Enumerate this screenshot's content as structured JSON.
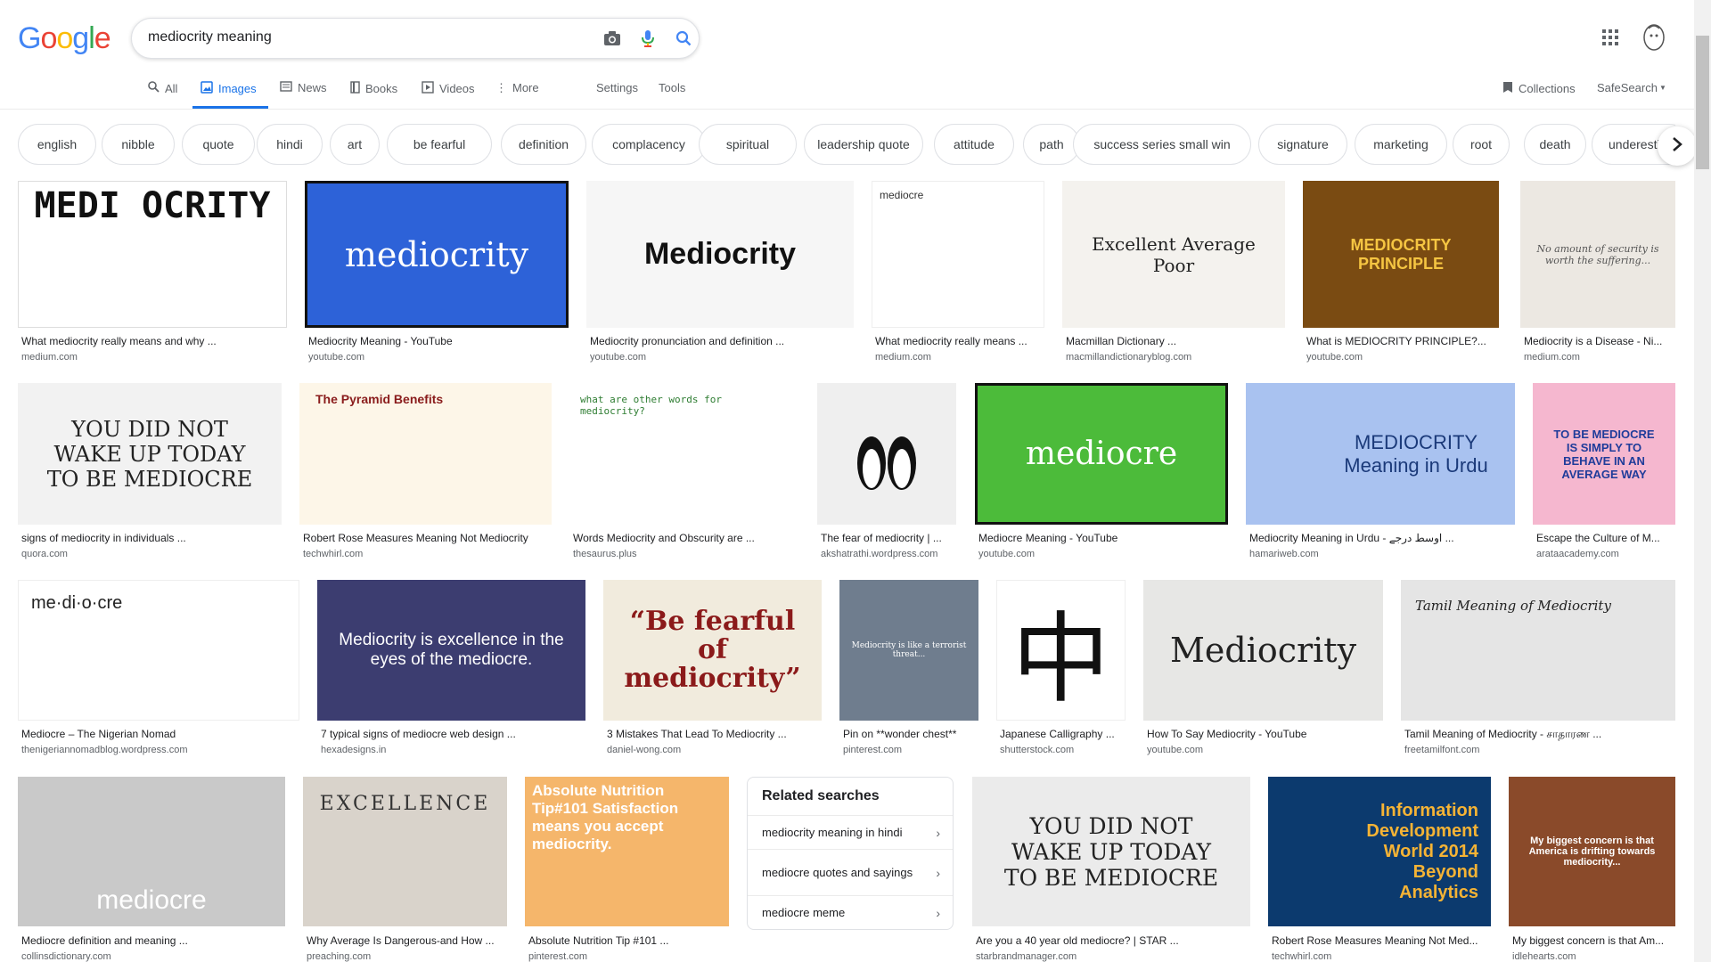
{
  "header": {
    "logo": [
      "G",
      "o",
      "o",
      "g",
      "l",
      "e"
    ],
    "logo_colors": [
      "#4285F4",
      "#EA4335",
      "#FBBC05",
      "#4285F4",
      "#34A853",
      "#EA4335"
    ],
    "query": "mediocrity meaning"
  },
  "tabs": [
    {
      "label": "All",
      "icon": "search-icon"
    },
    {
      "label": "Images",
      "icon": "image-icon"
    },
    {
      "label": "News",
      "icon": "news-icon"
    },
    {
      "label": "Books",
      "icon": "book-icon"
    },
    {
      "label": "Videos",
      "icon": "video-icon"
    },
    {
      "label": "More",
      "icon": "more-icon"
    }
  ],
  "tools": {
    "settings": "Settings",
    "tools": "Tools",
    "collections": "Collections",
    "safesearch": "SafeSearch"
  },
  "chips": [
    "english",
    "nibble",
    "quote",
    "hindi",
    "art",
    "be fearful",
    "definition",
    "complacency",
    "spiritual",
    "leadership quote",
    "attitude",
    "path",
    "success series small win",
    "signature",
    "marketing",
    "root",
    "death",
    "underesti"
  ],
  "results": [
    {
      "title": "What mediocrity really means and why ...",
      "site": "medium.com",
      "thumb_text": "MEDI OCRITY",
      "bg": "#ffffff",
      "fg": "#111111"
    },
    {
      "title": "Mediocrity Meaning - YouTube",
      "site": "youtube.com",
      "thumb_text": "mediocrity",
      "bg": "#2d62d8",
      "fg": "#ffffff"
    },
    {
      "title": "Mediocrity pronunciation and definition ...",
      "site": "youtube.com",
      "thumb_text": "Mediocrity",
      "bg": "#f6f6f6",
      "fg": "#111111"
    },
    {
      "title": "What mediocrity really means ...",
      "site": "medium.com",
      "thumb_text": "mediocre",
      "bg": "#ffffff",
      "fg": "#333333"
    },
    {
      "title": "Macmillan Dictionary ...",
      "site": "macmillandictionaryblog.com",
      "thumb_text": "Excellent Average Poor",
      "bg": "#f4f2ee",
      "fg": "#222222"
    },
    {
      "title": "What is MEDIOCRITY PRINCIPLE?...",
      "site": "youtube.com",
      "thumb_text": "MEDIOCRITY PRINCIPLE",
      "bg": "#7a4b12",
      "fg": "#f5c542"
    },
    {
      "title": "Mediocrity is a Disease - Ni...",
      "site": "medium.com",
      "thumb_text": "No amount of security is worth the suffering...",
      "bg": "#ece8e2",
      "fg": "#555555"
    },
    {
      "title": "signs of mediocrity in individuals ...",
      "site": "quora.com",
      "thumb_text": "YOU DID NOT WAKE UP TODAY TO BE MEDIOCRE",
      "bg": "#f2f2f2",
      "fg": "#222222"
    },
    {
      "title": "Robert Rose Measures Meaning Not Mediocrity",
      "site": "techwhirl.com",
      "thumb_text": "The Pyramid Benefits",
      "bg": "#fdf6e8",
      "fg": "#8a1c1c"
    },
    {
      "title": "Words Mediocrity and Obscurity are ...",
      "site": "thesaurus.plus",
      "thumb_text": "what are other words for mediocrity?",
      "bg": "#ffffff",
      "fg": "#2e7d32"
    },
    {
      "title": "The fear of mediocrity | ...",
      "site": "akshatrathi.wordpress.com",
      "thumb_text": "penguins",
      "bg": "#efefef",
      "fg": "#222222"
    },
    {
      "title": "Mediocre Meaning - YouTube",
      "site": "youtube.com",
      "thumb_text": "mediocre",
      "bg": "#4cbb3a",
      "fg": "#ffffff"
    },
    {
      "title": "Mediocrity Meaning in Urdu - اوسط درجے ...",
      "site": "hamariweb.com",
      "thumb_text": "MEDIOCRITY Meaning in Urdu",
      "bg": "#a9c2f0",
      "fg": "#1b3a7a"
    },
    {
      "title": "Escape the Culture of M...",
      "site": "arataacademy.com",
      "thumb_text": "TO BE MEDIOCRE IS SIMPLY TO BEHAVE IN AN AVERAGE WAY",
      "bg": "#f5b7cf",
      "fg": "#1f3c9a"
    },
    {
      "title": "Mediocre – The Nigerian Nomad",
      "site": "thenigeriannomadblog.wordpress.com",
      "thumb_text": "me·di·o·cre",
      "bg": "#ffffff",
      "fg": "#222222"
    },
    {
      "title": "7 typical signs of mediocre web design ...",
      "site": "hexadesigns.in",
      "thumb_text": "Mediocrity is excellence in the eyes of the mediocre.",
      "bg": "#3c3d70",
      "fg": "#ffffff"
    },
    {
      "title": "3 Mistakes That Lead To Mediocrity ...",
      "site": "daniel-wong.com",
      "thumb_text": "“Be fearful of mediocrity”",
      "bg": "#f1ebdd",
      "fg": "#8b1a1a"
    },
    {
      "title": "Pin on **wonder chest**",
      "site": "pinterest.com",
      "thumb_text": "Mediocrity is like a terrorist threat...",
      "bg": "#6f7d8e",
      "fg": "#ffffff"
    },
    {
      "title": "Japanese Calligraphy ...",
      "site": "shutterstock.com",
      "thumb_text": "中",
      "bg": "#ffffff",
      "fg": "#111111"
    },
    {
      "title": "How To Say Mediocrity - YouTube",
      "site": "youtube.com",
      "thumb_text": "Mediocrity",
      "bg": "#e7e7e5",
      "fg": "#222222"
    },
    {
      "title": "Tamil Meaning of Mediocrity - சாதாரண ...",
      "site": "freetamilfont.com",
      "thumb_text": "Tamil Meaning of Mediocrity",
      "bg": "#e5e5e5",
      "fg": "#222222"
    },
    {
      "title": "Mediocre definition and meaning ...",
      "site": "collinsdictionary.com",
      "thumb_text": "mediocre",
      "bg": "#c9c9c9",
      "fg": "#ffffff"
    },
    {
      "title": "Why Average Is Dangerous-and How ...",
      "site": "preaching.com",
      "thumb_text": "EXCELLENCE",
      "bg": "#d9d3cb",
      "fg": "#333333"
    },
    {
      "title": "Absolute Nutrition Tip #101 ...",
      "site": "pinterest.com",
      "thumb_text": "Absolute Nutrition Tip#101 Satisfaction means you accept mediocrity.",
      "bg": "#f5b66b",
      "fg": "#ffffff"
    },
    {
      "title": "Are you a 40 year old mediocre? | STAR ...",
      "site": "starbrandmanager.com",
      "thumb_text": "YOU DID NOT WAKE UP TODAY TO BE MEDIOCRE",
      "bg": "#ebebeb",
      "fg": "#222222"
    },
    {
      "title": "Robert Rose Measures Meaning Not Med...",
      "site": "techwhirl.com",
      "thumb_text": "Information Development World 2014 Beyond Analytics",
      "bg": "#0c3a6e",
      "fg": "#f5b335"
    },
    {
      "title": "My biggest concern is that Am...",
      "site": "idlehearts.com",
      "thumb_text": "My biggest concern is that America is drifting towards mediocrity...",
      "bg": "#8a4a2a",
      "fg": "#ffffff"
    }
  ],
  "related": {
    "title": "Related searches",
    "items": [
      "mediocrity meaning in hindi",
      "mediocre quotes and sayings",
      "mediocre meme"
    ]
  }
}
